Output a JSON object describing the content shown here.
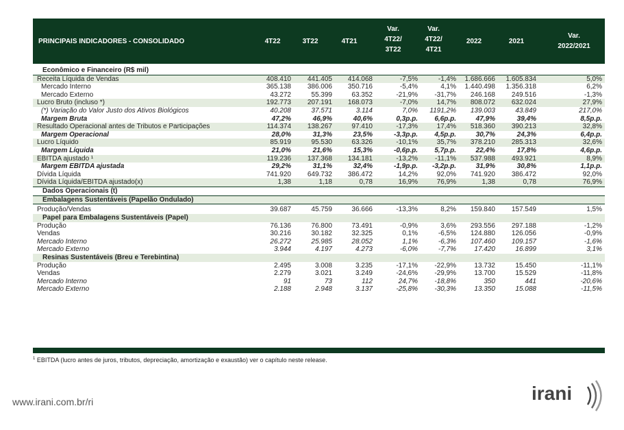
{
  "header": {
    "title": "PRINCIPAIS INDICADORES - CONSOLIDADO",
    "cols": [
      [
        "4T22"
      ],
      [
        "3T22"
      ],
      [
        "4T21"
      ],
      [
        "Var.",
        "4T22/",
        "3T22"
      ],
      [
        "Var.",
        "4T22/",
        "4T21"
      ],
      [
        "2022"
      ],
      [
        "2021"
      ],
      [
        "Var.",
        "2022/2021"
      ]
    ]
  },
  "rows": [
    {
      "label": "Econômico e Financeiro (R$ mil)",
      "type": "sec",
      "values": []
    },
    {
      "label": "Receita Líquida de Vendas",
      "type": "hl",
      "values": [
        "408.410",
        "441.405",
        "414.068",
        "-7,5%",
        "-1,4%",
        "1.686.666",
        "1.605.834",
        "5,0%"
      ]
    },
    {
      "label": "Mercado Interno",
      "type": "ind",
      "values": [
        "365.138",
        "386.006",
        "350.716",
        "-5,4%",
        "4,1%",
        "1.440.498",
        "1.356.318",
        "6,2%"
      ]
    },
    {
      "label": "Mercado Externo",
      "type": "ind",
      "values": [
        "43.272",
        "55.399",
        "63.352",
        "-21,9%",
        "-31,7%",
        "246.168",
        "249.516",
        "-1,3%"
      ]
    },
    {
      "label": "Lucro Bruto (incluso *)",
      "type": "hl",
      "values": [
        "192.773",
        "207.191",
        "168.073",
        "-7,0%",
        "14,7%",
        "808.072",
        "632.024",
        "27,9%"
      ]
    },
    {
      "label": "(*) Variação do Valor Justo dos Ativos Biológicos",
      "type": "ind ital",
      "values": [
        "40.208",
        "37.571",
        "3.114",
        "7,0%",
        "1191,2%",
        "139.003",
        "43.849",
        "217,0%"
      ]
    },
    {
      "label": "Margem Bruta",
      "type": "ind bold",
      "values": [
        "47,2%",
        "46,9%",
        "40,6%",
        "0,3p.p.",
        "6,6p.p.",
        "47,9%",
        "39,4%",
        "8,5p.p."
      ]
    },
    {
      "label": "Resultado Operacional antes de Tributos e Participações",
      "type": "hl",
      "values": [
        "114.374",
        "138.267",
        "97.410",
        "-17,3%",
        "17,4%",
        "518.360",
        "390.213",
        "32,8%"
      ]
    },
    {
      "label": "Margem Operacional",
      "type": "ind bold",
      "values": [
        "28,0%",
        "31,3%",
        "23,5%",
        "-3,3p.p.",
        "4,5p.p.",
        "30,7%",
        "24,3%",
        "6,4p.p."
      ]
    },
    {
      "label": "Lucro Líquido",
      "type": "hl",
      "values": [
        "85.919",
        "95.530",
        "63.326",
        "-10,1%",
        "35,7%",
        "378.210",
        "285.313",
        "32,6%"
      ]
    },
    {
      "label": "Margem Líquida",
      "type": "ind bold",
      "values": [
        "21,0%",
        "21,6%",
        "15,3%",
        "-0,6p.p.",
        "5,7p.p.",
        "22,4%",
        "17,8%",
        "4,6p.p."
      ]
    },
    {
      "label": "EBITDA ajustado ¹",
      "type": "hl",
      "values": [
        "119.236",
        "137.368",
        "134.181",
        "-13,2%",
        "-11,1%",
        "537.988",
        "493.921",
        "8,9%"
      ]
    },
    {
      "label": "Margem EBITDA ajustada",
      "type": "ind bold",
      "values": [
        "29,2%",
        "31,1%",
        "32,4%",
        "-1,9p.p.",
        "-3,2p.p.",
        "31,9%",
        "30,8%",
        "1,1p.p."
      ]
    },
    {
      "label": "Dívida Líquida",
      "type": "plain",
      "values": [
        "741.920",
        "649.732",
        "386.472",
        "14,2%",
        "92,0%",
        "741.920",
        "386.472",
        "92,0%"
      ]
    },
    {
      "label": "Dívida Líquida/EBITDA ajustado(x)",
      "type": "hl",
      "values": [
        "1,38",
        "1,18",
        "0,78",
        "16,9%",
        "76,9%",
        "1,38",
        "0,78",
        "76,9%"
      ]
    },
    {
      "label": "Dados Operacionais (t)",
      "type": "sec",
      "values": []
    },
    {
      "label": "Embalagens Sustentáveis  (Papelão Ondulado)",
      "type": "sec hl",
      "values": []
    },
    {
      "label": "Produção/Vendas",
      "type": "plain",
      "values": [
        "39.687",
        "45.759",
        "36.666",
        "-13,3%",
        "8,2%",
        "159.840",
        "157.549",
        "1,5%"
      ]
    },
    {
      "label": "Papel para Embalagens Sustentáveis (Papel)",
      "type": "sec hl",
      "values": []
    },
    {
      "label": "Produção",
      "type": "plain",
      "values": [
        "76.136",
        "76.800",
        "73.491",
        "-0,9%",
        "3,6%",
        "293.556",
        "297.188",
        "-1,2%"
      ]
    },
    {
      "label": "Vendas",
      "type": "plain",
      "values": [
        "30.216",
        "30.182",
        "32.325",
        "0,1%",
        "-6,5%",
        "124.880",
        "126.056",
        "-0,9%"
      ]
    },
    {
      "label": "Mercado Interno",
      "type": "ital",
      "values": [
        "26.272",
        "25.985",
        "28.052",
        "1,1%",
        "-6,3%",
        "107.460",
        "109.157",
        "-1,6%"
      ]
    },
    {
      "label": "Mercado Externo",
      "type": "ital",
      "values": [
        "3.944",
        "4.197",
        "4.273",
        "-6,0%",
        "-7,7%",
        "17.420",
        "16.899",
        "3,1%"
      ]
    },
    {
      "label": "Resinas Sustentáveis (Breu e Terebintina)",
      "type": "sec hl",
      "values": []
    },
    {
      "label": "Produção",
      "type": "plain",
      "values": [
        "2.495",
        "3.008",
        "3.235",
        "-17,1%",
        "-22,9%",
        "13.732",
        "15.450",
        "-11,1%"
      ]
    },
    {
      "label": "Vendas",
      "type": "plain",
      "values": [
        "2.279",
        "3.021",
        "3.249",
        "-24,6%",
        "-29,9%",
        "13.700",
        "15.529",
        "-11,8%"
      ]
    },
    {
      "label": "Mercado Interno",
      "type": "ital",
      "values": [
        "91",
        "73",
        "112",
        "24,7%",
        "-18,8%",
        "350",
        "441",
        "-20,6%"
      ]
    },
    {
      "label": "Mercado Externo",
      "type": "ital",
      "values": [
        "2.188",
        "2.948",
        "3.137",
        "-25,8%",
        "-30,3%",
        "13.350",
        "15.088",
        "-11,5%"
      ]
    }
  ],
  "footnote": {
    "mark": "1",
    "text": "EBITDA (lucro antes de juros, tributos, depreciação, amortização e exaustão) ver o capítulo neste release."
  },
  "url": "www.irani.com.br/ri",
  "logo": "irani"
}
